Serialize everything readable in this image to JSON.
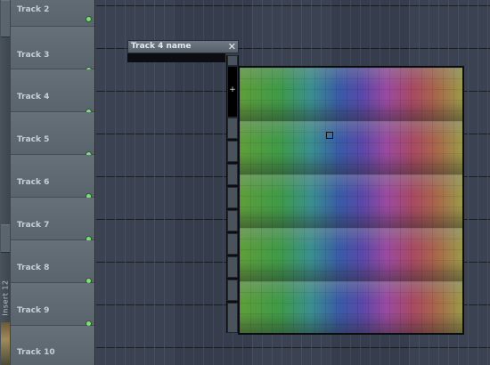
{
  "sidebar": {
    "insert_label": "Insert 12"
  },
  "tracks": [
    {
      "name": "Track 2"
    },
    {
      "name": "Track 3"
    },
    {
      "name": "Track 4"
    },
    {
      "name": "Track 5"
    },
    {
      "name": "Track 6"
    },
    {
      "name": "Track 7"
    },
    {
      "name": "Track 8"
    },
    {
      "name": "Track 9"
    },
    {
      "name": "Track 10"
    }
  ],
  "name_dialog": {
    "title": "Track 4 name",
    "close_symbol": "✕",
    "input_value": ""
  },
  "color_picker": {
    "plus_symbol": "+",
    "selected_color": "#3a4e9a"
  },
  "colors": {
    "header_bg": "#5a646d",
    "grid_bg": "#3b4252",
    "track_text": "#c7cfd6",
    "led_green": "#7be07a"
  }
}
